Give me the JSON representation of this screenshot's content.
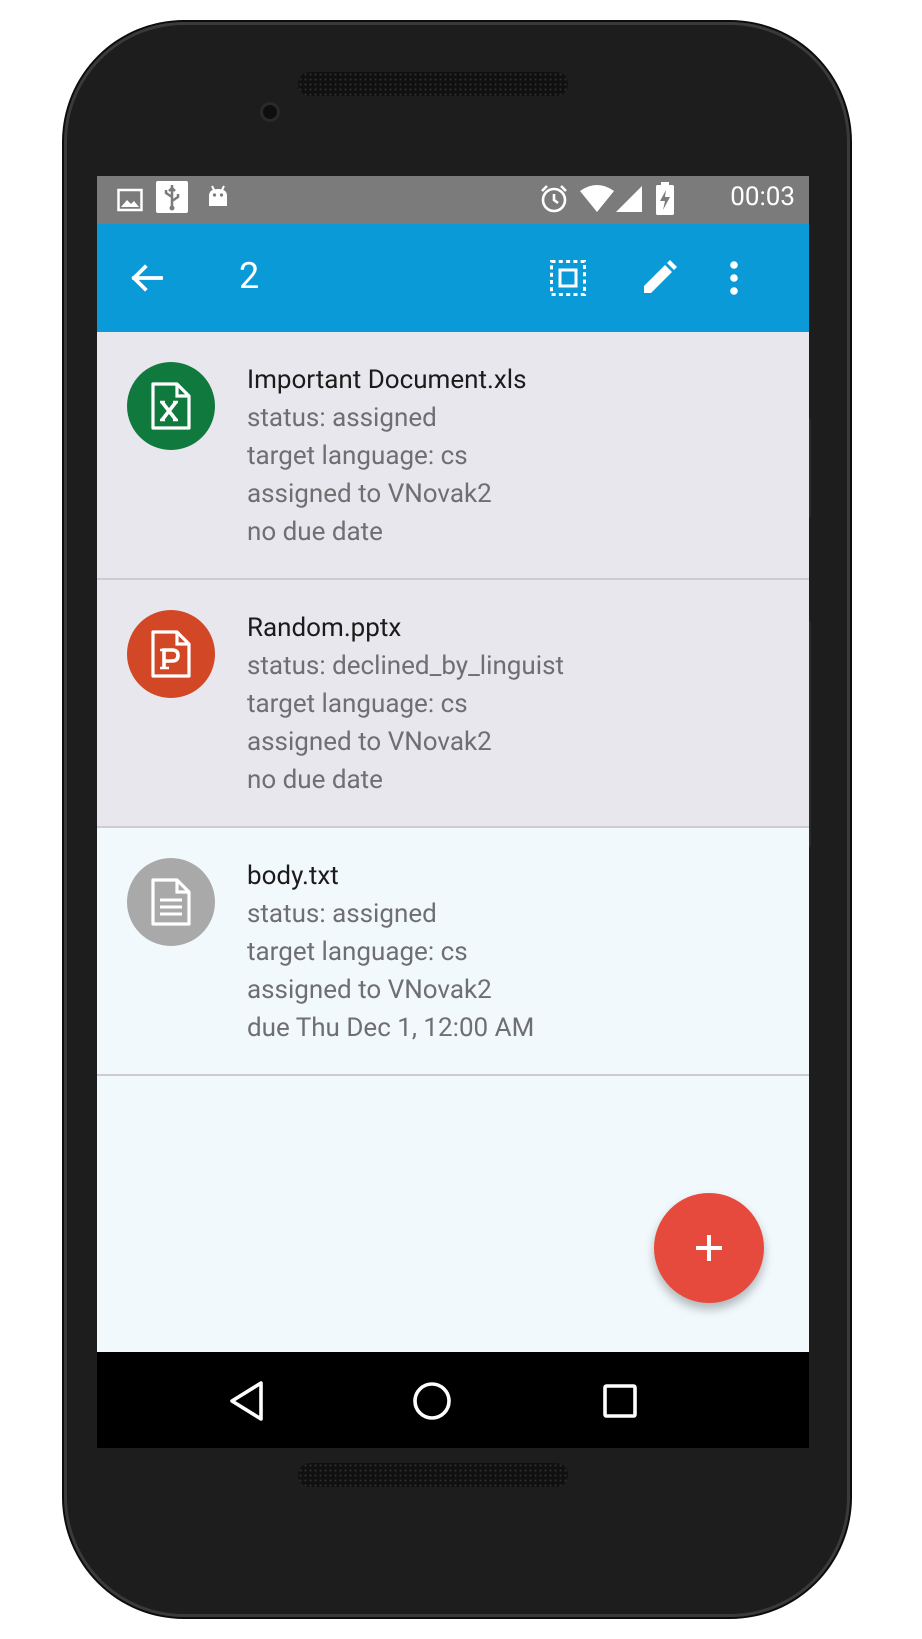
{
  "status_bar": {
    "time": "00:03",
    "left_icons": [
      "image-icon",
      "usb-icon",
      "android-icon"
    ],
    "right_icons": [
      "alarm-icon",
      "wifi-icon",
      "signal-icon",
      "battery-charging-icon"
    ]
  },
  "app_bar": {
    "title": "2",
    "actions": [
      "select-all-icon",
      "edit-icon",
      "more-vert-icon"
    ]
  },
  "items": [
    {
      "name": "Important Document.xls",
      "status": "status: assigned",
      "language": "target language: cs",
      "assignee": "assigned to VNovak2",
      "due": "no due date",
      "icon": "excel-file-icon",
      "icon_color": "#107a3e",
      "selected": true
    },
    {
      "name": "Random.pptx",
      "status": "status: declined_by_linguist",
      "language": "target language: cs",
      "assignee": "assigned to VNovak2",
      "due": "no due date",
      "icon": "powerpoint-file-icon",
      "icon_color": "#d24726",
      "selected": true
    },
    {
      "name": "body.txt",
      "status": "status: assigned",
      "language": "target language: cs",
      "assignee": "assigned to VNovak2",
      "due": "due Thu Dec 1, 12:00 AM",
      "icon": "text-file-icon",
      "icon_color": "#a9a9a9",
      "selected": false
    }
  ],
  "fab": {
    "icon": "plus-icon",
    "color": "#e64a3c"
  },
  "nav_bar": {
    "buttons": [
      "back-triangle-icon",
      "home-circle-icon",
      "recents-square-icon"
    ]
  },
  "colors": {
    "app_bar": "#0a9ad8",
    "status_bar": "#7b7b7b",
    "selected_row": "#e7e7ed",
    "background": "#f1f9fd"
  }
}
